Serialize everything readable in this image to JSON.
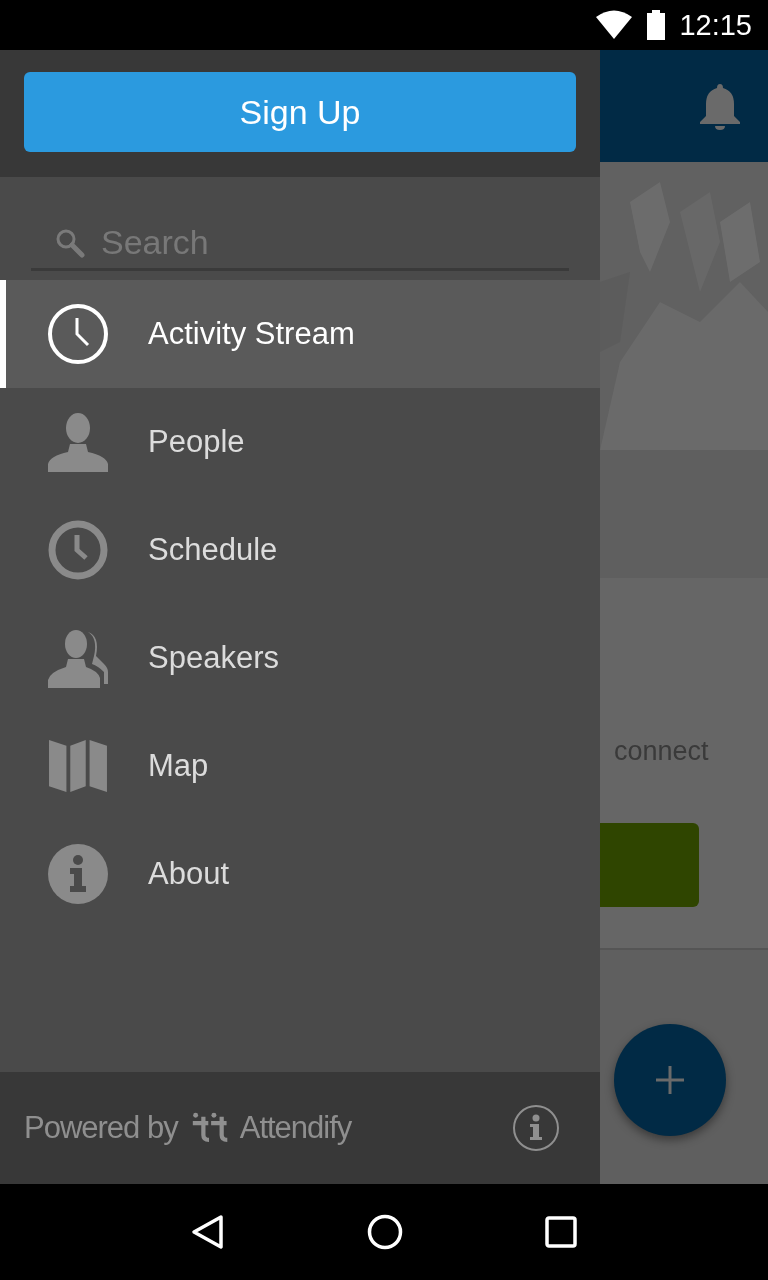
{
  "status_bar": {
    "time": "12:15"
  },
  "drawer": {
    "sign_up_button": "Sign Up",
    "search": {
      "placeholder": "Search"
    },
    "items": [
      {
        "label": "Activity Stream",
        "kind": "clock",
        "selected": true
      },
      {
        "label": "People",
        "kind": "person",
        "selected": false
      },
      {
        "label": "Schedule",
        "kind": "clock",
        "selected": false
      },
      {
        "label": "Speakers",
        "kind": "people",
        "selected": false
      },
      {
        "label": "Map",
        "kind": "map",
        "selected": false
      },
      {
        "label": "About",
        "kind": "info",
        "selected": false
      }
    ],
    "footer": {
      "powered_by": "Powered by",
      "brand": "Attendify"
    }
  },
  "background": {
    "card_text": "connect"
  }
}
